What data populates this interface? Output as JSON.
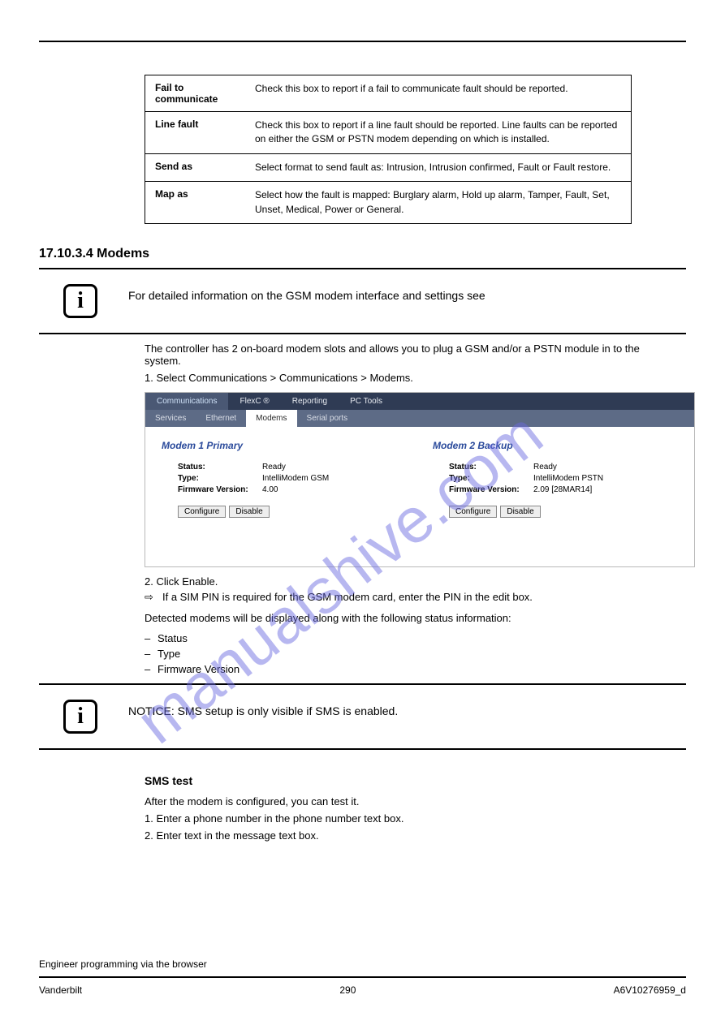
{
  "watermark": "manualshive.com",
  "def_table": [
    {
      "k": "Fail to communicate",
      "v": "Check this box to report if a fail to communicate fault should be reported."
    },
    {
      "k": "Line fault",
      "v": "Check this box to report if a line fault should be reported. Line faults can be reported on either the GSM or PSTN modem depending on which is installed."
    },
    {
      "k": "Send as",
      "v": "Select format to send fault as: Intrusion, Intrusion confirmed, Fault or Fault restore."
    },
    {
      "k": "Map as",
      "v": "Select how the fault is mapped: Burglary alarm, Hold up alarm, Tamper, Fault, Set, Unset, Medical, Power or General."
    }
  ],
  "section1": {
    "title": "17.10.3.4   Modems",
    "note": "For detailed information on the GSM modem interface and settings see",
    "para": "The controller has 2 on-board modem slots and allows you to plug a GSM and/or a PSTN module in to the system.",
    "step1": "1.   Select Communications > Communications > Modems.",
    "step2": "2.   Click Enable.",
    "aside": "If a SIM PIN is required for the GSM modem card, enter the PIN in the edit box.",
    "detected": "Detected modems will be displayed along with the following status information:",
    "bullets": [
      "Status",
      "Type",
      "Firmware Version"
    ]
  },
  "shot": {
    "tabs1": [
      "Communications",
      "FlexC ®",
      "Reporting",
      "PC Tools"
    ],
    "tabs1_active": 0,
    "tabs2": [
      "Services",
      "Ethernet",
      "Modems",
      "Serial ports"
    ],
    "tabs2_active": 2,
    "modems": [
      {
        "title": "Modem 1 Primary",
        "status_k": "Status:",
        "status_v": "Ready",
        "type_k": "Type:",
        "type_v": "IntelliModem GSM",
        "fw_k": "Firmware Version:",
        "fw_v": "4.00",
        "btn1": "Configure",
        "btn2": "Disable"
      },
      {
        "title": "Modem 2 Backup",
        "status_k": "Status:",
        "status_v": "Ready",
        "type_k": "Type:",
        "type_v": "IntelliModem PSTN",
        "fw_k": "Firmware Version:",
        "fw_v": "2.09 [28MAR14]",
        "btn1": "Configure",
        "btn2": "Disable"
      }
    ]
  },
  "sms_test": {
    "title": "SMS test",
    "p": "After the modem is configured, you can test it.",
    "s1": "1.   Enter a phone number in the phone number text box.",
    "s2": "2.   Enter text in the message text box."
  },
  "note2": "NOTICE: SMS setup is only visible if SMS is enabled.",
  "footer": {
    "left_top": "Engineer programming via the browser",
    "left_bot": "Vanderbilt",
    "center": "290",
    "right": "A6V10276959_d"
  }
}
